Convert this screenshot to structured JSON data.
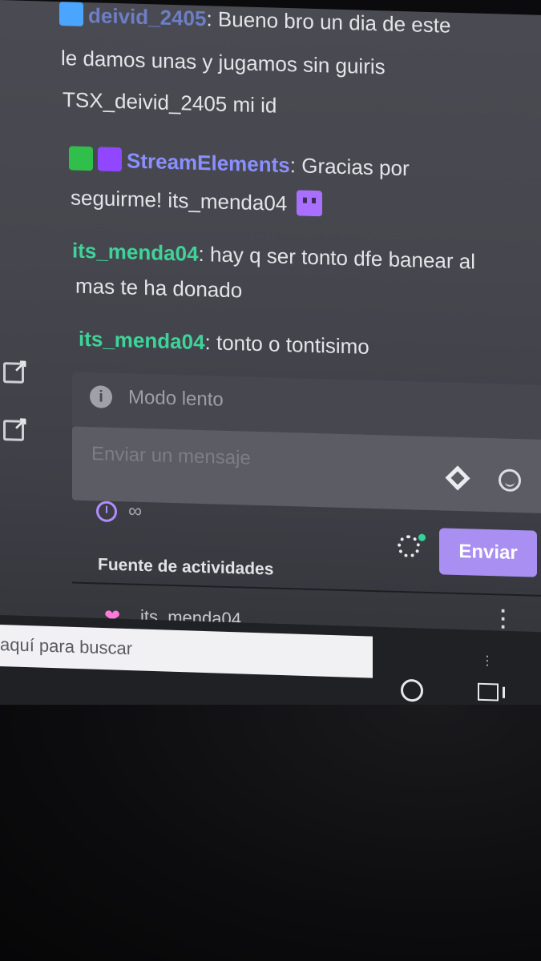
{
  "chat": {
    "messages": [
      {
        "user": "deivid_2405",
        "badges": [
          "crown-badge"
        ],
        "lines": [
          "Bueno bro un dia de este",
          "le damos unas y jugamos sin guiris",
          "TSX_deivid_2405 mi id"
        ]
      },
      {
        "user": "StreamElements",
        "badges": [
          "sword-badge",
          "verified-badge"
        ],
        "lines": [
          "Gracias por",
          "seguirme! its_menda04"
        ],
        "emote": "glitch-emote"
      },
      {
        "user": "its_menda04",
        "lines": [
          "hay q ser tonto dfe banear al",
          "mas te ha donado"
        ]
      },
      {
        "user": "its_menda04",
        "lines": [
          "tonto o tontisimo"
        ]
      }
    ],
    "separator": ": "
  },
  "slow_mode": {
    "label": "Modo lento"
  },
  "input": {
    "placeholder": "Enviar un mensaje"
  },
  "controls": {
    "timer_value": "∞",
    "send_label": "Enviar"
  },
  "activity_feed": {
    "title": "Fuente de actividades",
    "items": [
      {
        "user": "its_menda04"
      }
    ]
  },
  "taskbar": {
    "search_placeholder": "aquí para buscar",
    "menu": "⋮"
  },
  "colors": {
    "accent": "#a98ff2",
    "username_green": "#3fd39a",
    "username_purple": "#8a8fff",
    "online_dot": "#34d399"
  }
}
